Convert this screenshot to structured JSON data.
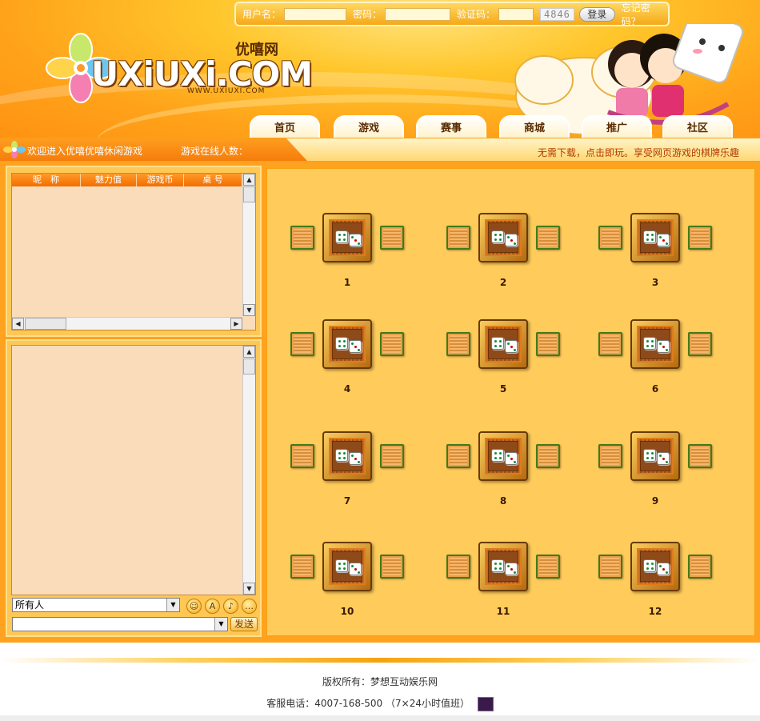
{
  "login": {
    "username_label": "用户名：",
    "password_label": "密码：",
    "captcha_label": "验证码：",
    "captcha_code": "4846",
    "login_button": "登录",
    "forgot_password": "忘记密码？"
  },
  "brand": {
    "logo_text": "UXiUXi.COM",
    "logo_cn": "优嘻网",
    "logo_url": "WWW.UXIUXI.COM"
  },
  "nav": {
    "tabs": [
      {
        "label": "首页"
      },
      {
        "label": "游戏"
      },
      {
        "label": "赛事"
      },
      {
        "label": "商城"
      },
      {
        "label": "推广"
      },
      {
        "label": "社区"
      }
    ]
  },
  "strip": {
    "welcome": "欢迎进入优嘻优嘻休闲游戏",
    "online": "游戏在线人数：",
    "slogan": "无需下载，点击即玩。享受网页游戏的棋牌乐趣"
  },
  "userlist": {
    "columns": [
      "昵　称",
      "魅力值",
      "游戏币",
      "桌 号"
    ]
  },
  "chat": {
    "recipient": "所有人",
    "message_value": "",
    "send_button": "发送",
    "emoticons": [
      "smile-icon",
      "font-icon",
      "sound-icon",
      "more-icon"
    ]
  },
  "tables": [
    {
      "number": "1"
    },
    {
      "number": "2"
    },
    {
      "number": "3"
    },
    {
      "number": "4"
    },
    {
      "number": "5"
    },
    {
      "number": "6"
    },
    {
      "number": "7"
    },
    {
      "number": "8"
    },
    {
      "number": "9"
    },
    {
      "number": "10"
    },
    {
      "number": "11"
    },
    {
      "number": "12"
    }
  ],
  "footer": {
    "copyright": "版权所有：梦想互动娱乐网",
    "phone": "客服电话：4007-168-500 （7×24小时值班）"
  },
  "colors": {
    "brand_orange": "#ffa21f",
    "panel_bg": "#ffcb5a",
    "list_bg": "#fbdcba",
    "chair_border": "#3f7a1a"
  }
}
